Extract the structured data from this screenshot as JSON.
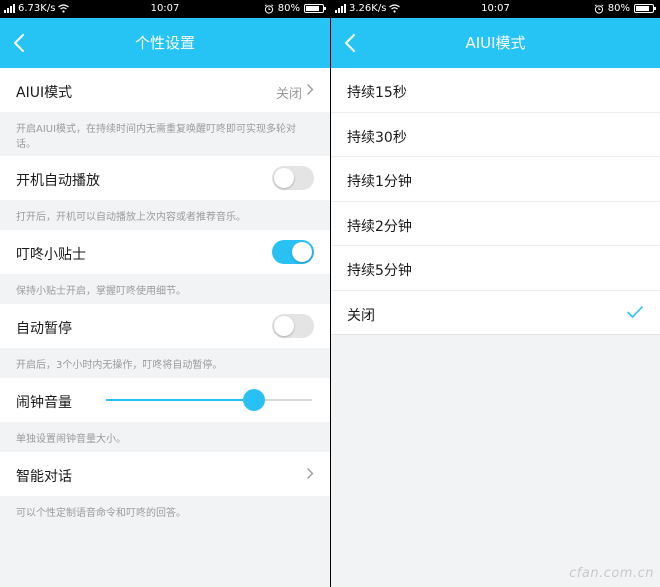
{
  "left_screen": {
    "status_bar": {
      "speed": "6.73K/s",
      "time": "10:07",
      "battery": "80%",
      "battery_level": 0.8
    },
    "nav": {
      "title": "个性设置"
    },
    "rows": {
      "aiui": {
        "label": "AIUI模式",
        "value": "关闭"
      },
      "aiui_desc": "开启AIUI模式，在持续时间内无需重复唤醒叮咚即可实现多轮对话。",
      "autoplay": {
        "label": "开机自动播放",
        "on": false
      },
      "autoplay_desc": "打开后，开机可以自动播放上次内容或者推荐音乐。",
      "tips": {
        "label": "叮咚小贴士",
        "on": true
      },
      "tips_desc": "保持小贴士开启，掌握叮咚使用细节。",
      "autopause": {
        "label": "自动暂停",
        "on": false
      },
      "autopause_desc": "开启后，3个小时内无操作，叮咚将自动暂停。",
      "alarm_volume": {
        "label": "闹钟音量",
        "level": 0.72
      },
      "alarm_volume_desc": "单独设置闹钟音量大小。",
      "smart_dialog": {
        "label": "智能对话"
      },
      "smart_dialog_desc": "可以个性定制语音命令和叮咚的回答。"
    }
  },
  "right_screen": {
    "status_bar": {
      "speed": "3.26K/s",
      "time": "10:07",
      "battery": "80%",
      "battery_level": 0.8
    },
    "nav": {
      "title": "AIUI模式"
    },
    "options": [
      {
        "label": "持续15秒",
        "selected": false
      },
      {
        "label": "持续30秒",
        "selected": false
      },
      {
        "label": "持续1分钟",
        "selected": false
      },
      {
        "label": "持续2分钟",
        "selected": false
      },
      {
        "label": "持续5分钟",
        "selected": false
      },
      {
        "label": "关闭",
        "selected": true
      }
    ]
  },
  "watermark": "cfan.com.cn",
  "colors": {
    "accent": "#26c3f5",
    "toggle_on": "#29c1f3",
    "toggle_off": "#e4e4e4",
    "page_bg": "#f2f3f5",
    "desc_text": "#9b9b9b"
  },
  "icons": {
    "back": "chevron-left-icon",
    "chevron": "chevron-right-icon",
    "check": "check-icon",
    "wifi": "wifi-icon",
    "alarm": "alarm-icon",
    "battery": "battery-icon",
    "signal": "signal-icon"
  }
}
